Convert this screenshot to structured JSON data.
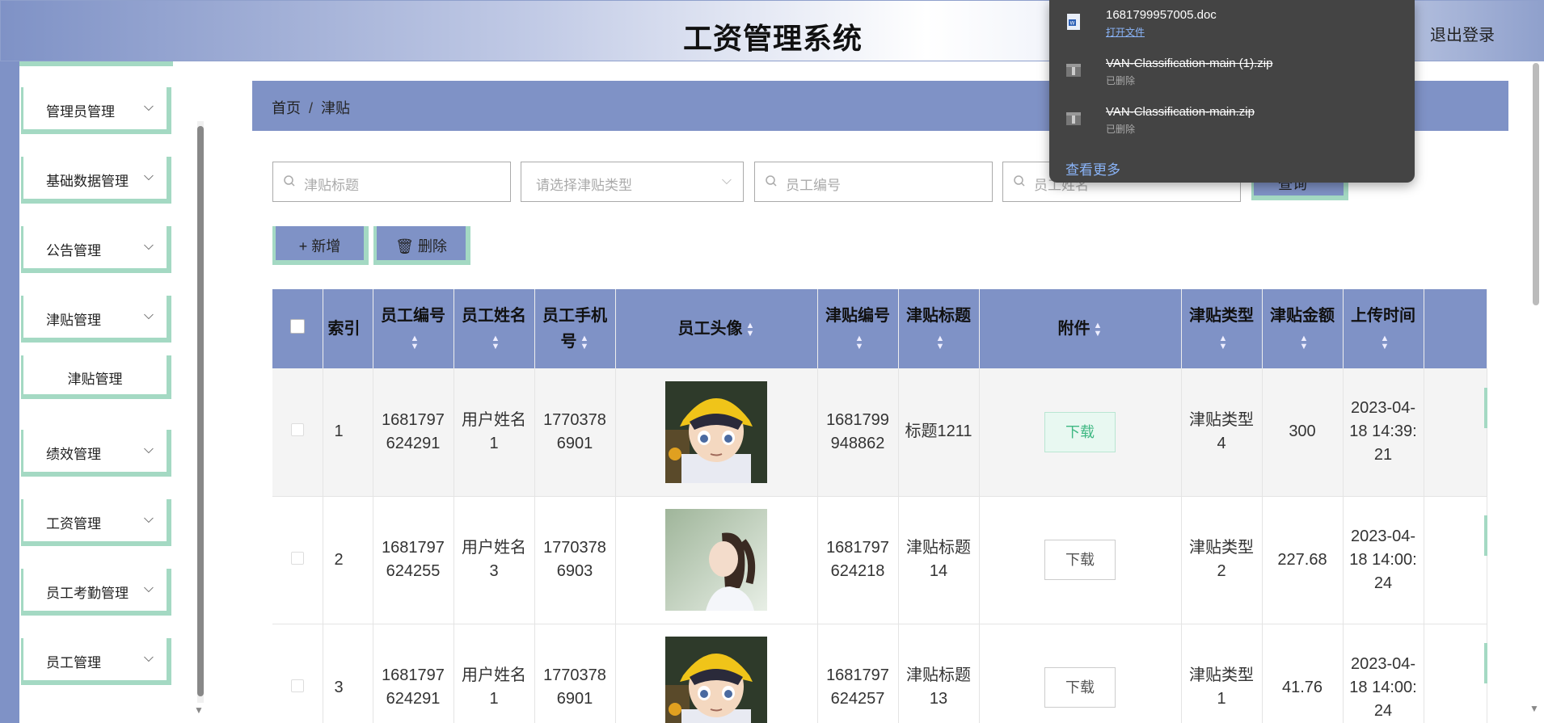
{
  "header": {
    "title": "工资管理系统",
    "logout_label": "退出登录"
  },
  "sidebar": {
    "items": [
      {
        "label": "管理员管理"
      },
      {
        "label": "基础数据管理"
      },
      {
        "label": "公告管理"
      },
      {
        "label": "津贴管理"
      },
      {
        "label": "津贴管理",
        "sub": true
      },
      {
        "label": "绩效管理"
      },
      {
        "label": "工资管理"
      },
      {
        "label": "员工考勤管理"
      },
      {
        "label": "员工管理"
      }
    ]
  },
  "breadcrumb": {
    "home": "首页",
    "sep": "/",
    "current": "津贴"
  },
  "search": {
    "title_placeholder": "津贴标题",
    "type_placeholder": "请选择津贴类型",
    "emp_no_placeholder": "员工编号",
    "emp_name_placeholder": "员工姓名",
    "button_label": "查询"
  },
  "actions": {
    "add_label": "+ 新增",
    "delete_label": "删除"
  },
  "table": {
    "headers": [
      "索引",
      "员工编号",
      "员工姓名",
      "员工手机号",
      "员工头像",
      "津贴编号",
      "津贴标题",
      "附件",
      "津贴类型",
      "津贴金额",
      "上传时间"
    ],
    "rows": [
      {
        "index": "1",
        "emp_no": "1681797624291",
        "emp_name": "用户姓名1",
        "phone": "17703786901",
        "avatar": "boy-yellow-hat",
        "allow_no": "1681799948862",
        "title": "标题1211",
        "attach": "下载",
        "type": "津贴类型4",
        "amount": "300",
        "time": "2023-04-18 14:39:21"
      },
      {
        "index": "2",
        "emp_no": "1681797624255",
        "emp_name": "用户姓名3",
        "phone": "17703786903",
        "avatar": "girl-profile",
        "allow_no": "1681797624218",
        "title": "津贴标题14",
        "attach": "下载",
        "type": "津贴类型2",
        "amount": "227.68",
        "time": "2023-04-18 14:00:24"
      },
      {
        "index": "3",
        "emp_no": "1681797624291",
        "emp_name": "用户姓名1",
        "phone": "17703786901",
        "avatar": "boy-yellow-hat",
        "allow_no": "1681797624257",
        "title": "津贴标题13",
        "attach": "下载",
        "type": "津贴类型1",
        "amount": "41.76",
        "time": "2023-04-18 14:00:24"
      }
    ]
  },
  "downloads": {
    "items": [
      {
        "file": "1681799957005.doc",
        "status": "打开文件",
        "deleted": false
      },
      {
        "file": "VAN-Classification-main (1).zip",
        "status": "已删除",
        "deleted": true
      },
      {
        "file": "VAN-Classification-main.zip",
        "status": "已删除",
        "deleted": true
      }
    ],
    "see_more": "查看更多"
  },
  "colors": {
    "accent": "#7f92c6",
    "border_accent": "#a4d9c3",
    "download_panel": "#444444"
  }
}
